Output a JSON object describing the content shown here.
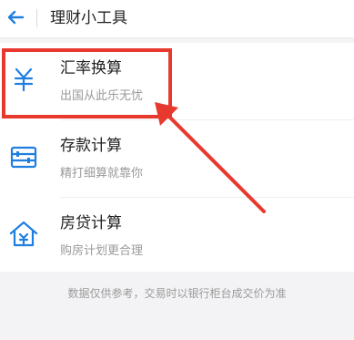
{
  "header": {
    "back_icon": "back-arrow-icon",
    "title": "理财小工具"
  },
  "items": [
    {
      "icon": "yen-icon",
      "title": "汇率换算",
      "subtitle": "出国从此乐无忧"
    },
    {
      "icon": "abacus-icon",
      "title": "存款计算",
      "subtitle": "精打细算就靠你"
    },
    {
      "icon": "house-yen-icon",
      "title": "房贷计算",
      "subtitle": "购房计划更合理"
    }
  ],
  "footnote": "数据仅供参考，交易时以银行柜台成交价为准",
  "colors": {
    "accent": "#1f7fe0",
    "annotation": "#e8392f"
  }
}
